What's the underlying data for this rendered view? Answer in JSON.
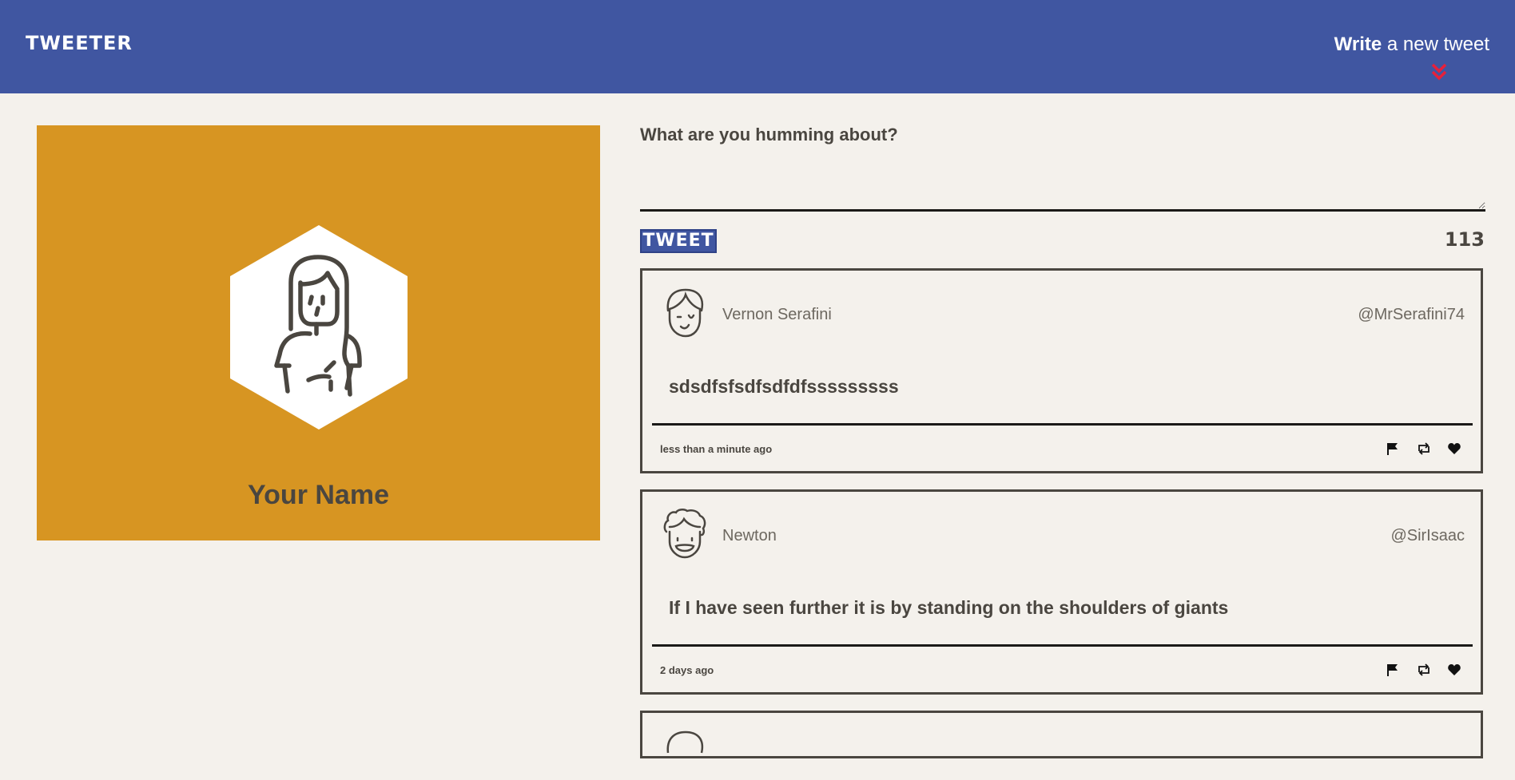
{
  "header": {
    "logo": "TWEETER",
    "compose_bold": "Write",
    "compose_rest": " a new tweet"
  },
  "profile": {
    "name": "Your Name"
  },
  "composer": {
    "label": "What are you humming about?",
    "value": "",
    "button_label": "TWEET",
    "counter": "113"
  },
  "tweets": [
    {
      "name": "Vernon Serafini",
      "handle": "@MrSerafini74",
      "body": "sdsdfsfsdfsdfdfsssssssss",
      "time": "less than a minute ago"
    },
    {
      "name": "Newton",
      "handle": "@SirIsaac",
      "body": "If I have seen further it is by standing on the shoulders of giants",
      "time": "2 days ago"
    }
  ],
  "colors": {
    "header_bg": "#4056a1",
    "profile_bg": "#d79522",
    "page_bg": "#f4f1ec",
    "text": "#4a4640",
    "chevron": "#e8203a"
  }
}
